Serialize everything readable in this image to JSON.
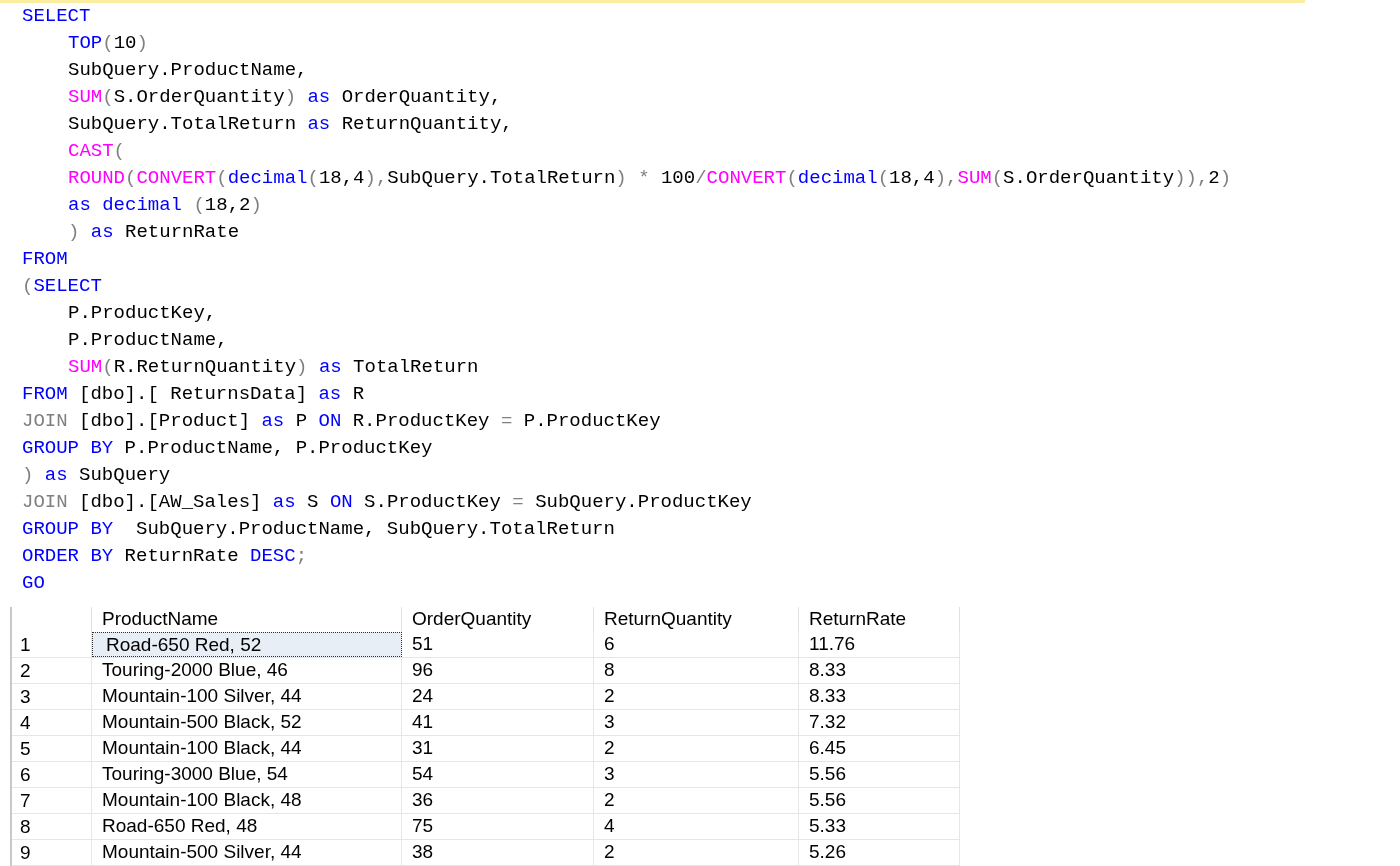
{
  "editor": {
    "lines": [
      {
        "indented": false,
        "tokens": [
          {
            "kind": "keyword",
            "text": "SELECT"
          }
        ]
      },
      {
        "indented": true,
        "tokens": [
          {
            "kind": "keyword",
            "text": "TOP"
          },
          {
            "kind": "operator",
            "text": "("
          },
          {
            "kind": "plain",
            "text": "10"
          },
          {
            "kind": "operator",
            "text": ")"
          }
        ]
      },
      {
        "indented": true,
        "tokens": [
          {
            "kind": "plain",
            "text": "SubQuery.ProductName,"
          }
        ]
      },
      {
        "indented": true,
        "tokens": [
          {
            "kind": "function",
            "text": "SUM"
          },
          {
            "kind": "operator",
            "text": "("
          },
          {
            "kind": "plain",
            "text": "S.OrderQuantity"
          },
          {
            "kind": "operator",
            "text": ") "
          },
          {
            "kind": "keyword",
            "text": "as"
          },
          {
            "kind": "plain",
            "text": " OrderQuantity,"
          }
        ]
      },
      {
        "indented": true,
        "tokens": [
          {
            "kind": "plain",
            "text": "SubQuery.TotalReturn "
          },
          {
            "kind": "keyword",
            "text": "as"
          },
          {
            "kind": "plain",
            "text": " ReturnQuantity,"
          }
        ]
      },
      {
        "indented": true,
        "tokens": [
          {
            "kind": "function",
            "text": "CAST"
          },
          {
            "kind": "operator",
            "text": "("
          }
        ]
      },
      {
        "indented": true,
        "tokens": [
          {
            "kind": "function",
            "text": "ROUND"
          },
          {
            "kind": "operator",
            "text": "("
          },
          {
            "kind": "function",
            "text": "CONVERT"
          },
          {
            "kind": "operator",
            "text": "("
          },
          {
            "kind": "keyword",
            "text": "decimal"
          },
          {
            "kind": "operator",
            "text": "("
          },
          {
            "kind": "plain",
            "text": "18,4"
          },
          {
            "kind": "operator",
            "text": "),"
          },
          {
            "kind": "plain",
            "text": "SubQuery.TotalReturn"
          },
          {
            "kind": "operator",
            "text": ") * "
          },
          {
            "kind": "plain",
            "text": "100"
          },
          {
            "kind": "operator",
            "text": "/"
          },
          {
            "kind": "function",
            "text": "CONVERT"
          },
          {
            "kind": "operator",
            "text": "("
          },
          {
            "kind": "keyword",
            "text": "decimal"
          },
          {
            "kind": "operator",
            "text": "("
          },
          {
            "kind": "plain",
            "text": "18,4"
          },
          {
            "kind": "operator",
            "text": "),"
          },
          {
            "kind": "function",
            "text": "SUM"
          },
          {
            "kind": "operator",
            "text": "("
          },
          {
            "kind": "plain",
            "text": "S.OrderQuantity"
          },
          {
            "kind": "operator",
            "text": ")),"
          },
          {
            "kind": "plain",
            "text": "2"
          },
          {
            "kind": "operator",
            "text": ")"
          }
        ]
      },
      {
        "indented": true,
        "tokens": [
          {
            "kind": "keyword",
            "text": "as decimal"
          },
          {
            "kind": "operator",
            "text": " ("
          },
          {
            "kind": "plain",
            "text": "18,2"
          },
          {
            "kind": "operator",
            "text": ")"
          }
        ]
      },
      {
        "indented": true,
        "tokens": [
          {
            "kind": "operator",
            "text": ") "
          },
          {
            "kind": "keyword",
            "text": "as"
          },
          {
            "kind": "plain",
            "text": " ReturnRate"
          }
        ]
      },
      {
        "indented": false,
        "tokens": [
          {
            "kind": "keyword",
            "text": "FROM"
          }
        ]
      },
      {
        "indented": false,
        "tokens": [
          {
            "kind": "operator",
            "text": "("
          },
          {
            "kind": "keyword",
            "text": "SELECT"
          }
        ]
      },
      {
        "indented": true,
        "tokens": [
          {
            "kind": "plain",
            "text": "P.ProductKey,"
          }
        ]
      },
      {
        "indented": true,
        "tokens": [
          {
            "kind": "plain",
            "text": "P.ProductName,"
          }
        ]
      },
      {
        "indented": true,
        "tokens": [
          {
            "kind": "function",
            "text": "SUM"
          },
          {
            "kind": "operator",
            "text": "("
          },
          {
            "kind": "plain",
            "text": "R.ReturnQuantity"
          },
          {
            "kind": "operator",
            "text": ") "
          },
          {
            "kind": "keyword",
            "text": "as"
          },
          {
            "kind": "plain",
            "text": " TotalReturn"
          }
        ]
      },
      {
        "indented": false,
        "tokens": [
          {
            "kind": "keyword",
            "text": "FROM"
          },
          {
            "kind": "plain",
            "text": " [dbo].[ ReturnsData] "
          },
          {
            "kind": "keyword",
            "text": "as"
          },
          {
            "kind": "plain",
            "text": " R"
          }
        ]
      },
      {
        "indented": false,
        "tokens": [
          {
            "kind": "operator",
            "text": "JOIN"
          },
          {
            "kind": "plain",
            "text": " [dbo].[Product] "
          },
          {
            "kind": "keyword",
            "text": "as"
          },
          {
            "kind": "plain",
            "text": " P "
          },
          {
            "kind": "keyword",
            "text": "ON"
          },
          {
            "kind": "plain",
            "text": " R.ProductKey "
          },
          {
            "kind": "operator",
            "text": "="
          },
          {
            "kind": "plain",
            "text": " P.ProductKey"
          }
        ]
      },
      {
        "indented": false,
        "tokens": [
          {
            "kind": "keyword",
            "text": "GROUP BY"
          },
          {
            "kind": "plain",
            "text": " P.ProductName, P.ProductKey"
          }
        ]
      },
      {
        "indented": false,
        "tokens": [
          {
            "kind": "operator",
            "text": ") "
          },
          {
            "kind": "keyword",
            "text": "as"
          },
          {
            "kind": "plain",
            "text": " SubQuery"
          }
        ]
      },
      {
        "indented": false,
        "tokens": [
          {
            "kind": "operator",
            "text": "JOIN"
          },
          {
            "kind": "plain",
            "text": " [dbo].[AW_Sales] "
          },
          {
            "kind": "keyword",
            "text": "as"
          },
          {
            "kind": "plain",
            "text": " S "
          },
          {
            "kind": "keyword",
            "text": "ON"
          },
          {
            "kind": "plain",
            "text": " S.ProductKey "
          },
          {
            "kind": "operator",
            "text": "="
          },
          {
            "kind": "plain",
            "text": " SubQuery.ProductKey"
          }
        ]
      },
      {
        "indented": false,
        "tokens": [
          {
            "kind": "keyword",
            "text": "GROUP BY"
          },
          {
            "kind": "plain",
            "text": "  SubQuery.ProductName, SubQuery.TotalReturn"
          }
        ]
      },
      {
        "indented": false,
        "tokens": [
          {
            "kind": "keyword",
            "text": "ORDER BY"
          },
          {
            "kind": "plain",
            "text": " ReturnRate "
          },
          {
            "kind": "keyword",
            "text": "DESC"
          },
          {
            "kind": "operator",
            "text": ";"
          }
        ]
      },
      {
        "indented": false,
        "tokens": [
          {
            "kind": "keyword",
            "text": "GO"
          }
        ]
      }
    ]
  },
  "results": {
    "columns": [
      "ProductName",
      "OrderQuantity",
      "ReturnQuantity",
      "ReturnRate"
    ],
    "rows": [
      {
        "number": "1",
        "selected": true,
        "cells": [
          "Road-650 Red, 52",
          "51",
          "6",
          "11.76"
        ]
      },
      {
        "number": "2",
        "selected": false,
        "cells": [
          "Touring-2000 Blue, 46",
          "96",
          "8",
          "8.33"
        ]
      },
      {
        "number": "3",
        "selected": false,
        "cells": [
          "Mountain-100 Silver, 44",
          "24",
          "2",
          "8.33"
        ]
      },
      {
        "number": "4",
        "selected": false,
        "cells": [
          "Mountain-500 Black, 52",
          "41",
          "3",
          "7.32"
        ]
      },
      {
        "number": "5",
        "selected": false,
        "cells": [
          "Mountain-100 Black, 44",
          "31",
          "2",
          "6.45"
        ]
      },
      {
        "number": "6",
        "selected": false,
        "cells": [
          "Touring-3000 Blue, 54",
          "54",
          "3",
          "5.56"
        ]
      },
      {
        "number": "7",
        "selected": false,
        "cells": [
          "Mountain-100 Black, 48",
          "36",
          "2",
          "5.56"
        ]
      },
      {
        "number": "8",
        "selected": false,
        "cells": [
          "Road-650 Red, 48",
          "75",
          "4",
          "5.33"
        ]
      },
      {
        "number": "9",
        "selected": false,
        "cells": [
          "Mountain-500 Silver, 44",
          "38",
          "2",
          "5.26"
        ]
      }
    ]
  }
}
